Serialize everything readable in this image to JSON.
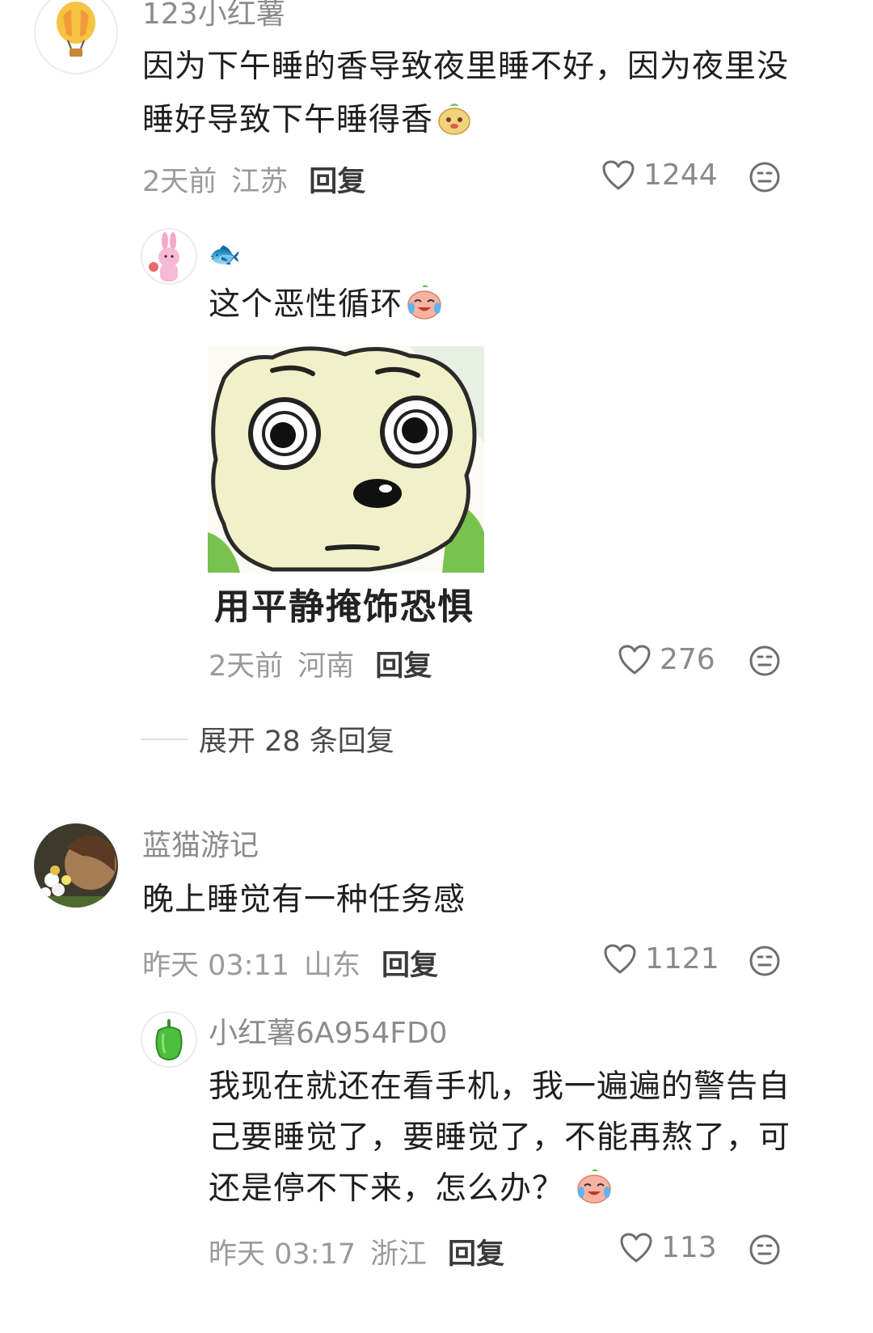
{
  "comments": [
    {
      "username": "123小红薯",
      "text": "因为下午睡的香导致夜里睡不好，因为夜里没睡好导致下午睡得香",
      "time": "2天前",
      "location": "江苏",
      "reply_label": "回复",
      "likes": "1244",
      "avatar_icon": "hot-air-balloon-icon",
      "reply": {
        "username": "🐟",
        "text": "这个恶性循环",
        "meme_caption": "用平静掩饰恐惧",
        "time": "2天前",
        "location": "河南",
        "reply_label": "回复",
        "likes": "276",
        "avatar_icon": "pink-rabbit-icon"
      },
      "expand_label": "展开 28 条回复"
    },
    {
      "username": "蓝猫游记",
      "text": "晚上睡觉有一种任务感",
      "time": "昨天 03:11",
      "location": "山东",
      "reply_label": "回复",
      "likes": "1121",
      "avatar_icon": "photo-avatar",
      "reply": {
        "username": "小红薯6A954FD0",
        "text": "我现在就还在看手机，我一遍遍的警告自己要睡觉了，要睡觉了，不能再熬了，可还是停不下来，怎么办？",
        "time": "昨天 03:17",
        "location": "浙江",
        "reply_label": "回复",
        "likes": "113",
        "avatar_icon": "green-pepper-icon"
      }
    }
  ]
}
